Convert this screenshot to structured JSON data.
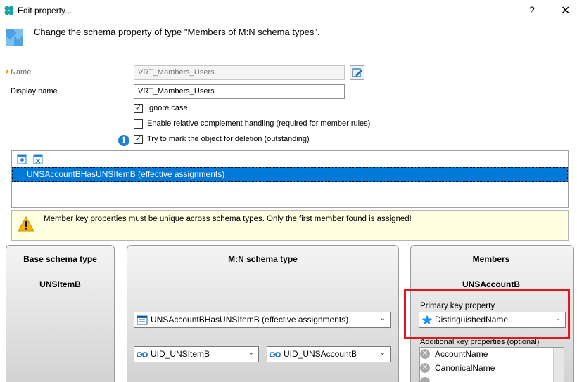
{
  "window": {
    "title": "Edit property...",
    "help_label": "?",
    "close_label": "✕"
  },
  "header": {
    "text": "Change the schema property of type \"Members of M:N schema types\"."
  },
  "form": {
    "name_label": "Name",
    "name_value": "VRT_Mambers_Users",
    "display_name_label": "Display name",
    "display_name_value": "VRT_Mambers_Users",
    "ignore_case_label": "Ignore case",
    "ignore_case_checked": true,
    "relative_complement_label": "Enable relative complement handling (required for member rules)",
    "relative_complement_checked": false,
    "mark_deletion_label": "Try to mark the object for deletion (outstanding)",
    "mark_deletion_checked": true
  },
  "member_list": {
    "items": [
      "UNSAccountBHasUNSItemB (effective assignments)"
    ]
  },
  "warning": {
    "text": "Member key properties must be unique across schema types. Only the first member found is assigned!"
  },
  "panels": {
    "base": {
      "title": "Base schema type",
      "type_name": "UNSItemB"
    },
    "mn": {
      "title": "M:N schema type",
      "combo_value": "UNSAccountBHasUNSItemB (effective assignments)",
      "left_key": "UID_UNSItemB",
      "right_key": "UID_UNSAccountB"
    },
    "members": {
      "title": "Members",
      "type_name": "UNSAccountB",
      "primary_key_label": "Primary key property",
      "primary_key_value": "DistinguishedName",
      "additional_label": "Additional key properties (optional)",
      "additional_items": [
        "AccountName",
        "CanonicalName"
      ]
    }
  },
  "colors": {
    "selection": "#0078d7",
    "highlight": "#e8141c",
    "warning_bg": "#ffffe1",
    "star": "#1e90ff"
  }
}
